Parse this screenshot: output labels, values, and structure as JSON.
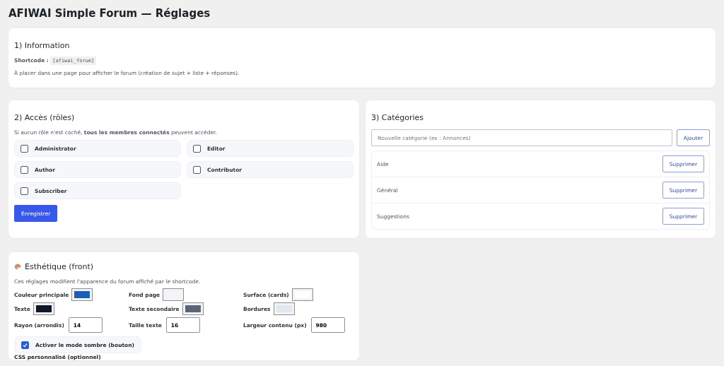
{
  "page_title": "AFIWAI Simple Forum — Réglages",
  "information": {
    "title": "1) Information",
    "shortcode_label": "Shortcode :",
    "shortcode": "[afiwai_forum]",
    "description": "À placer dans une page pour afficher le forum (création de sujet + liste + réponses)."
  },
  "access": {
    "title": "2) Accès (rôles)",
    "note": "Si aucun rôle n'est coché, **tous les membres connectés** peuvent accéder.",
    "roles": [
      {
        "label": "Administrator",
        "checked": false
      },
      {
        "label": "Editor",
        "checked": false
      },
      {
        "label": "Author",
        "checked": false
      },
      {
        "label": "Contributor",
        "checked": false
      },
      {
        "label": "Subscriber",
        "checked": false
      }
    ],
    "save_button": "Enregistrer"
  },
  "categories": {
    "title": "3) Catégories",
    "placeholder": "Nouvelle catégorie (ex : Annonces)",
    "add_button": "Ajouter",
    "items": [
      {
        "name": "Aide",
        "delete_button": "Supprimer"
      },
      {
        "name": "Général",
        "delete_button": "Supprimer"
      },
      {
        "name": "Suggestions",
        "delete_button": "Supprimer"
      }
    ]
  },
  "appearance": {
    "title": "Esthétique (front)",
    "note": "Ces réglages modifient l'apparence du forum affiché par le shortcode.",
    "fields": [
      {
        "kind": "color",
        "label": "Couleur principale",
        "color": "#1d5fb8"
      },
      {
        "kind": "color",
        "label": "Fond page",
        "color": "#f3f4f6"
      },
      {
        "kind": "color",
        "label": "Surface (cards)",
        "color": "#ffffff"
      },
      {
        "kind": "color",
        "label": "Texte",
        "color": "#0f172a"
      },
      {
        "kind": "color",
        "label": "Texte secondaire",
        "color": "#5b6478"
      },
      {
        "kind": "color",
        "label": "Bordures",
        "color": "#e2e8f0"
      },
      {
        "kind": "number",
        "label": "Rayon (arrondis)",
        "value": "14"
      },
      {
        "kind": "number",
        "label": "Taille texte",
        "value": "16"
      },
      {
        "kind": "number",
        "label": "Largeur contenu (px)",
        "value": "980"
      }
    ],
    "dark_mode": {
      "label": "Activer le mode sombre (bouton)",
      "checked": true
    },
    "custom_css_label": "CSS personnalisé (optionnel)"
  }
}
